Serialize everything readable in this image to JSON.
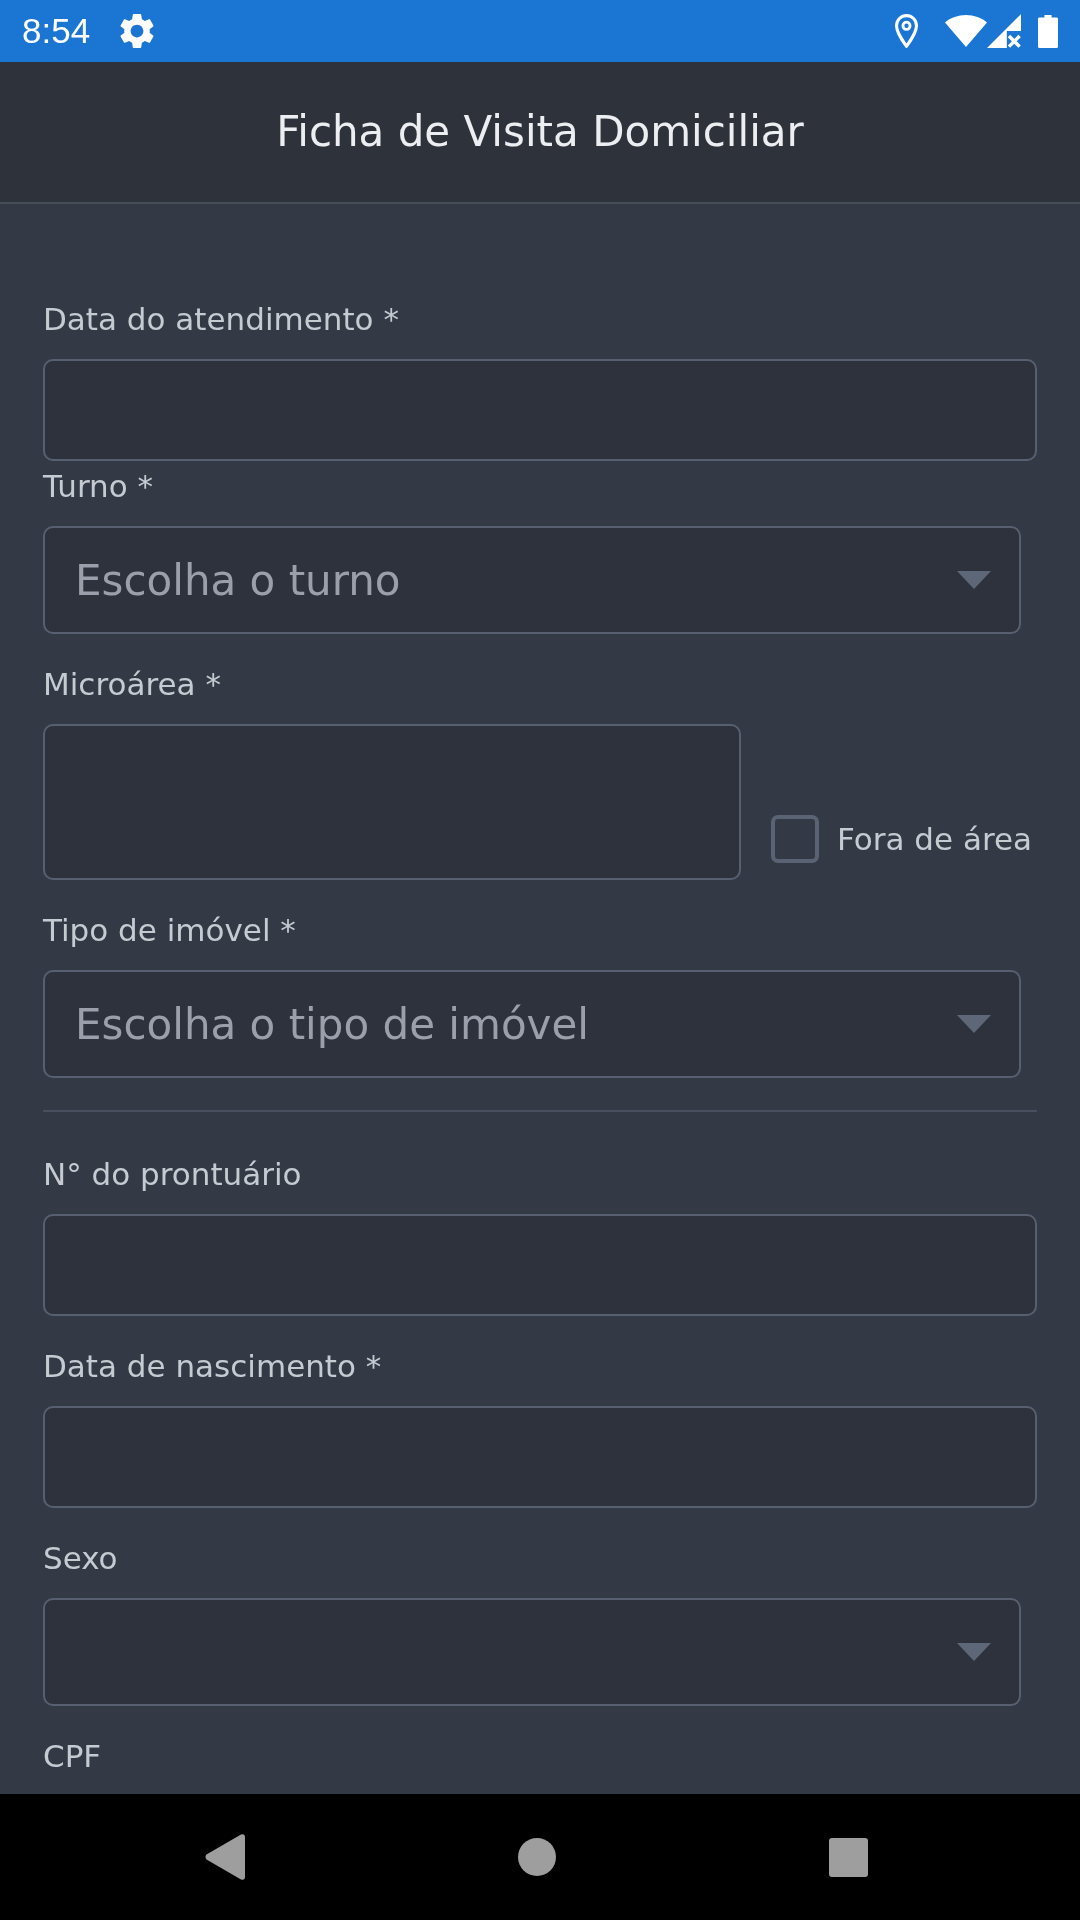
{
  "status_bar": {
    "time": "8:54"
  },
  "app_bar": {
    "title": "Ficha de Visita Domiciliar"
  },
  "form": {
    "fields": [
      {
        "kind": "text",
        "label": "Data do atendimento *"
      },
      {
        "kind": "select",
        "label": "Turno *",
        "placeholder": "Escolha o turno"
      },
      {
        "kind": "text_with_checkbox",
        "label": "Microárea *",
        "checkbox": {
          "label": "Fora de área",
          "checked": false
        }
      },
      {
        "kind": "select",
        "label": "Tipo de imóvel *",
        "placeholder": "Escolha o tipo de imóvel"
      },
      {
        "kind": "divider"
      },
      {
        "kind": "text",
        "label": "N° do prontuário"
      },
      {
        "kind": "text",
        "label": "Data de nascimento *"
      },
      {
        "kind": "select",
        "label": "Sexo"
      },
      {
        "kind": "label_only",
        "label": "CPF"
      }
    ]
  }
}
